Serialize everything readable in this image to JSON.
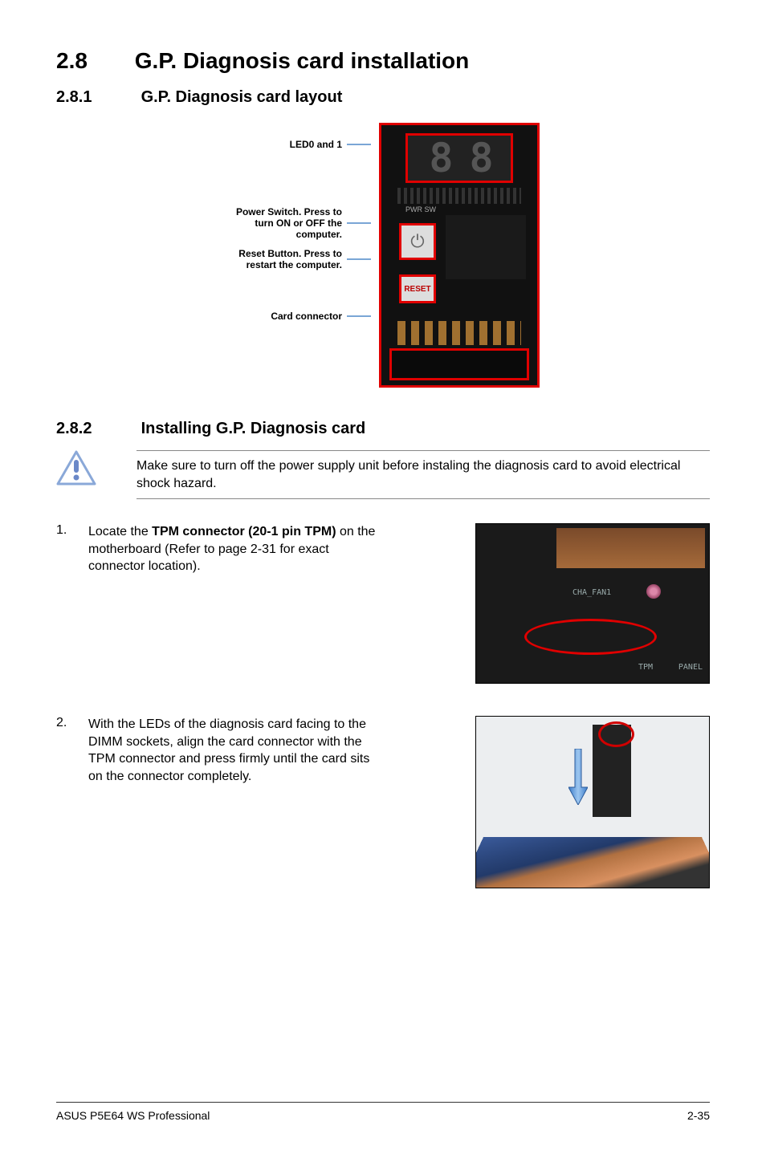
{
  "section": {
    "number": "2.8",
    "title": "G.P. Diagnosis card installation"
  },
  "subsection1": {
    "number": "2.8.1",
    "title": "G.P. Diagnosis card layout"
  },
  "card_labels": {
    "led": "LED0 and 1",
    "power": "Power Switch. Press to turn ON or OFF the computer.",
    "reset": "Reset Button. Press to restart the computer.",
    "connector": "Card connector"
  },
  "card_internal": {
    "pwr_sw": "PWR SW",
    "reset": "RESET",
    "seg": "8 8"
  },
  "subsection2": {
    "number": "2.8.2",
    "title": "Installing G.P. Diagnosis card"
  },
  "caution": {
    "text": "Make sure to turn off the power supply unit before instaling the diagnosis card to avoid electrical shock hazard."
  },
  "step1": {
    "num": "1.",
    "prefix": "Locate the ",
    "bold": "TPM connector (20-1 pin TPM)",
    "suffix": " on the motherboard (Refer to page 2-31 for exact connector location)."
  },
  "mb_labels": {
    "tpm": "TPM",
    "panel": "PANEL",
    "cha_fan": "CHA_FAN1"
  },
  "step2": {
    "num": "2.",
    "text": "With the LEDs of the diagnosis card facing to the DIMM sockets, align the card connector with the TPM connector and press firmly until the card sits on the connector completely."
  },
  "footer": {
    "left": "ASUS P5E64 WS Professional",
    "right": "2-35"
  }
}
